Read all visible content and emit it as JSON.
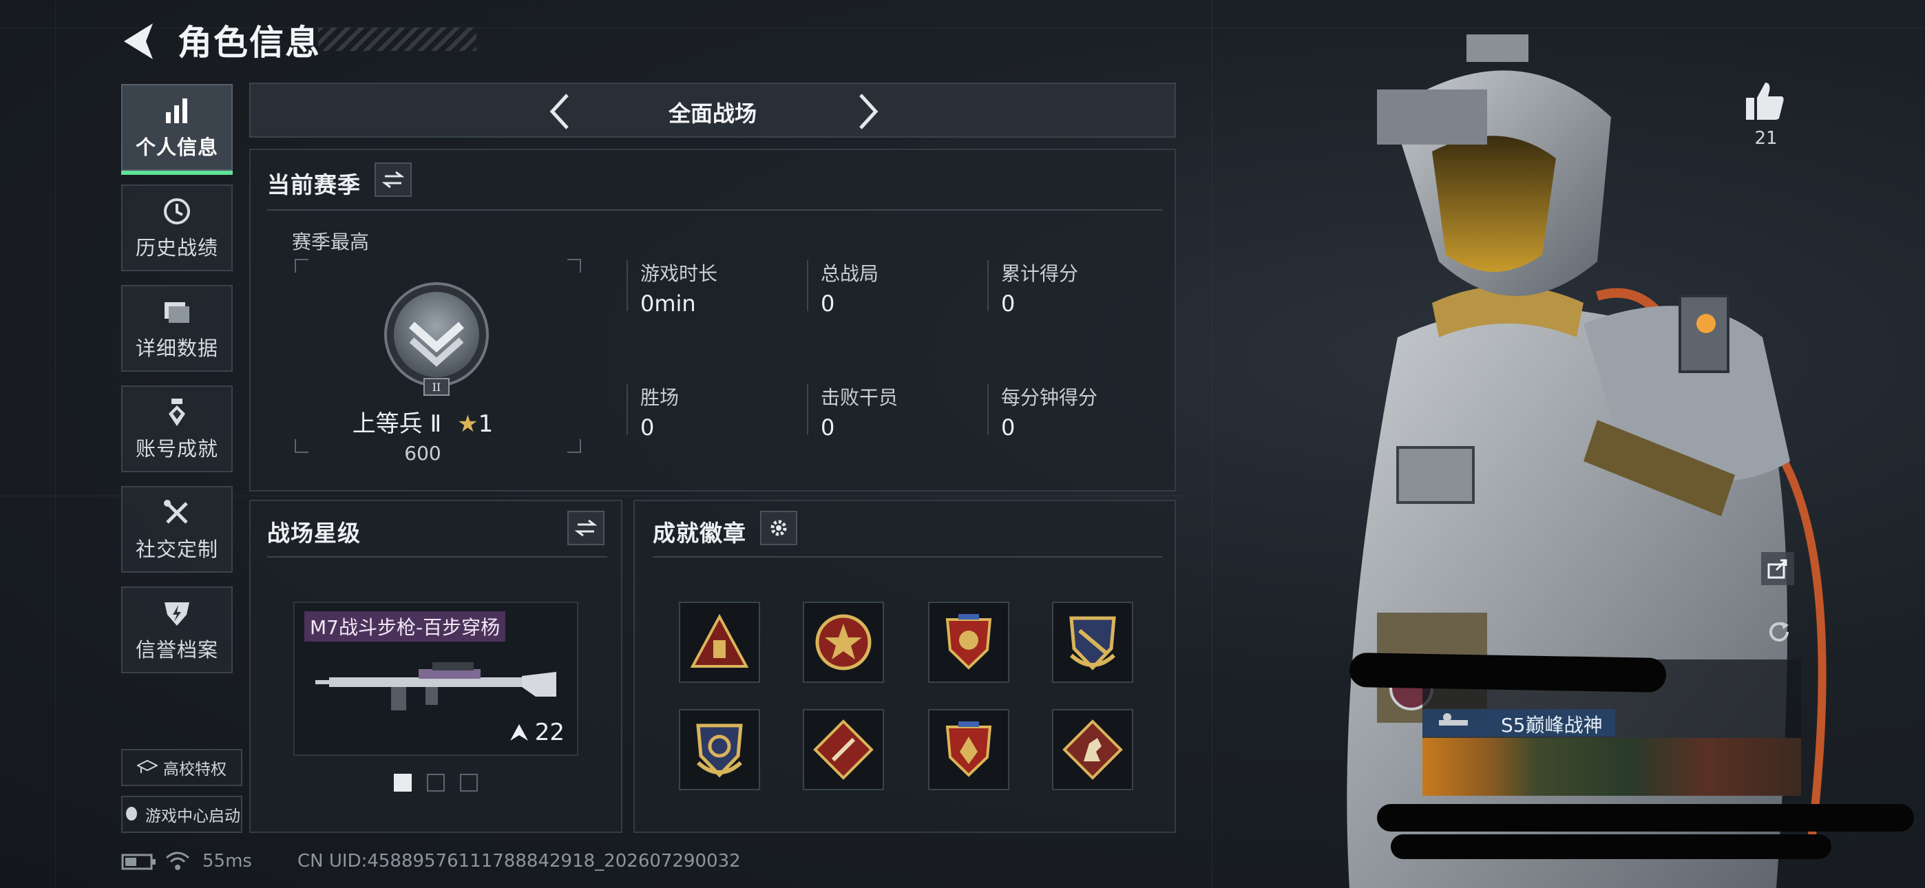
{
  "header": {
    "title": "角色信息"
  },
  "nav": {
    "items": [
      {
        "label": "个人信息",
        "icon": "bar-chart-icon",
        "active": true
      },
      {
        "label": "历史战绩",
        "icon": "history-clock-icon",
        "active": false
      },
      {
        "label": "详细数据",
        "icon": "folder-icon",
        "active": false
      },
      {
        "label": "账号成就",
        "icon": "achievement-medal-icon",
        "active": false
      },
      {
        "label": "社交定制",
        "icon": "tools-icon",
        "active": false
      },
      {
        "label": "信誉档案",
        "icon": "shield-icon",
        "active": false
      }
    ],
    "campus_button": "高校特权",
    "game_center_button": "游戏中心启动"
  },
  "mode": {
    "title": "全面战场"
  },
  "season": {
    "title": "当前赛季",
    "peak_label": "赛季最高",
    "rank_name": "上等兵 Ⅱ",
    "rank_stars": "1",
    "rank_points": "600",
    "rank_numeral": "II",
    "stats": [
      {
        "label": "游戏时长",
        "value": "0min"
      },
      {
        "label": "总战局",
        "value": "0"
      },
      {
        "label": "累计得分",
        "value": "0"
      },
      {
        "label": "胜场",
        "value": "0"
      },
      {
        "label": "击败干员",
        "value": "0"
      },
      {
        "label": "每分钟得分",
        "value": "0"
      }
    ]
  },
  "battlefield_level": {
    "title": "战场星级",
    "weapon_name": "M7战斗步枪-百步穿杨",
    "weapon_level": "22",
    "page_index": 0,
    "page_count": 3
  },
  "badges": {
    "title": "成就徽章",
    "items": [
      "badge-triangle-gold",
      "badge-star-red",
      "badge-shield-red",
      "badge-shield-gold",
      "badge-shield-blue",
      "badge-diamond-red",
      "badge-shield-red-2",
      "badge-diamond-horse"
    ]
  },
  "character": {
    "likes": "21",
    "nameplate_title": "S5巅峰战神"
  },
  "status_bar": {
    "ping": "55ms",
    "uid": "CN UID:45889576111788842918_202607290032"
  },
  "colors": {
    "accent": "#5fe39b",
    "panel_border": "#333b44",
    "gold": "#d9b45a"
  }
}
